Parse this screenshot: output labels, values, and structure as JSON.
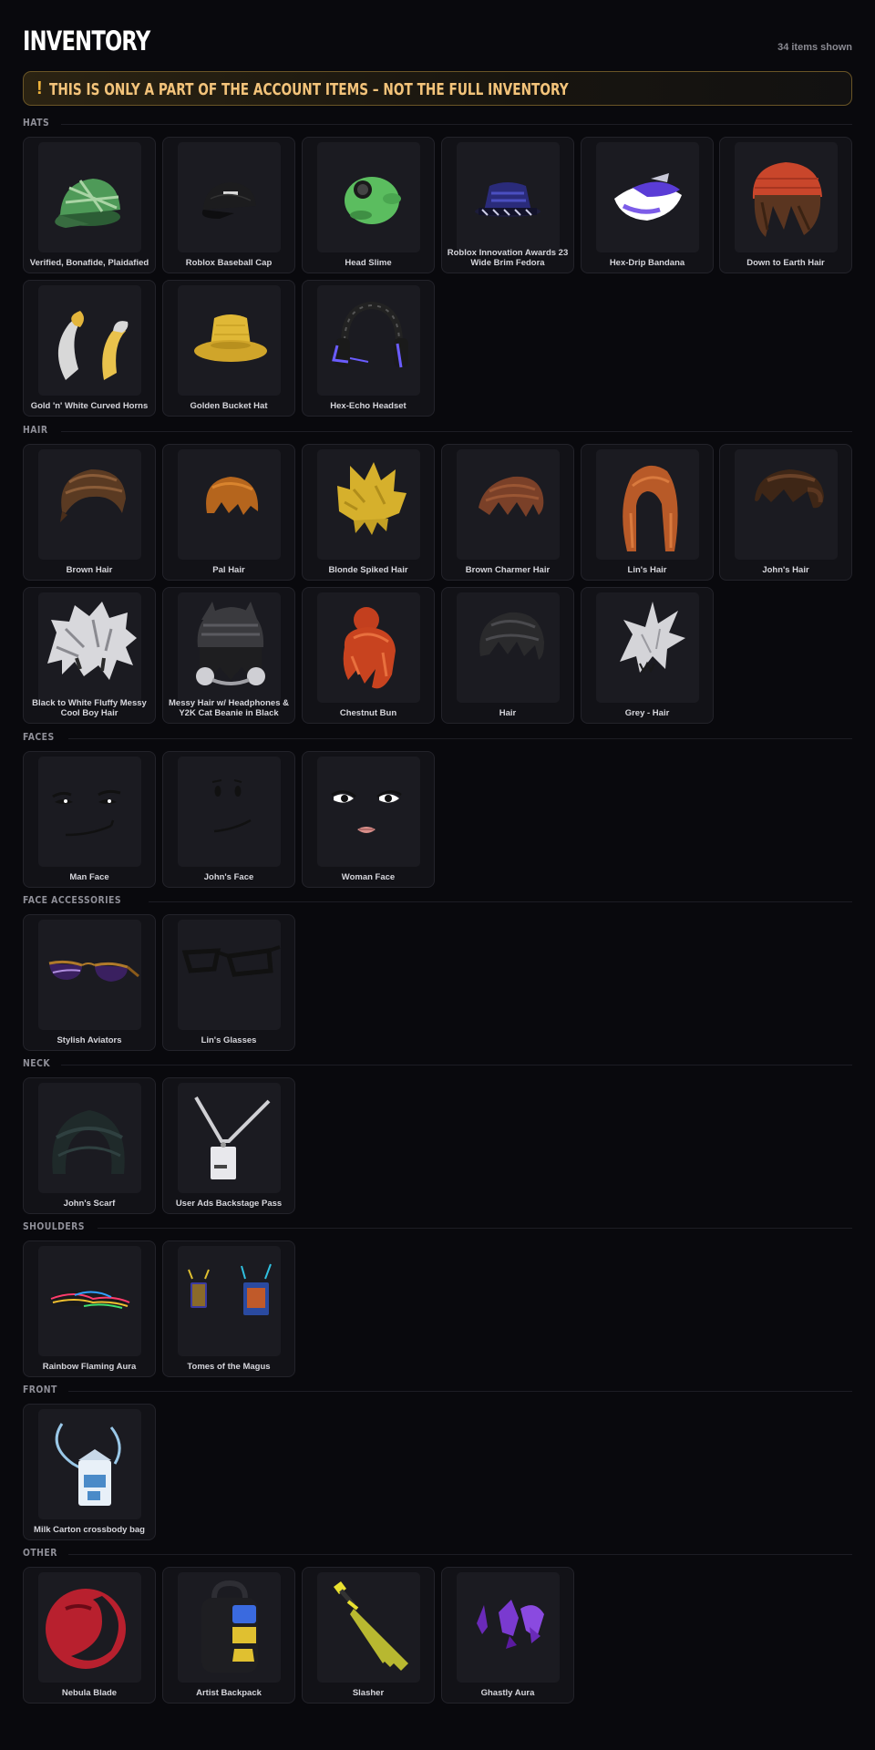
{
  "header": {
    "title": "INVENTORY",
    "count": "34 items shown"
  },
  "warning": {
    "mark": "!",
    "text": "THIS IS ONLY A PART OF THE ACCOUNT ITEMS – NOT THE FULL INVENTORY"
  },
  "sections": {
    "hats": {
      "label": "HATS",
      "items": [
        {
          "name": "Verified, Bonafide, Plaidafied",
          "icon": "green-plaid-cap-icon"
        },
        {
          "name": "Roblox Baseball Cap",
          "icon": "black-baseball-cap-icon"
        },
        {
          "name": "Head Slime",
          "icon": "green-slime-head-icon"
        },
        {
          "name": "Roblox Innovation Awards 23 Wide Brim Fedora",
          "icon": "blue-fedora-icon"
        },
        {
          "name": "Hex-Drip Bandana",
          "icon": "bandana-icon"
        },
        {
          "name": "Down to Earth Hair",
          "icon": "beanie-hair-icon"
        },
        {
          "name": "Gold 'n' White Curved Horns",
          "icon": "horns-icon"
        },
        {
          "name": "Golden Bucket Hat",
          "icon": "bucket-hat-icon"
        },
        {
          "name": "Hex-Echo Headset",
          "icon": "headset-icon"
        }
      ]
    },
    "hair": {
      "label": "HAIR",
      "items": [
        {
          "name": "Brown Hair",
          "icon": "brown-hair-icon"
        },
        {
          "name": "Pal Hair",
          "icon": "orange-hair-icon"
        },
        {
          "name": "Blonde Spiked Hair",
          "icon": "blonde-spiked-hair-icon"
        },
        {
          "name": "Brown Charmer Hair",
          "icon": "brown-charmer-hair-icon"
        },
        {
          "name": "Lin's Hair",
          "icon": "long-orange-hair-icon"
        },
        {
          "name": "John's Hair",
          "icon": "dark-brown-hair-icon"
        },
        {
          "name": "Black to White Fluffy Messy Cool Boy Hair",
          "icon": "fluffy-white-hair-icon"
        },
        {
          "name": "Messy Hair w/ Headphones & Y2K Cat Beanie in Black",
          "icon": "beanie-headphones-icon"
        },
        {
          "name": "Chestnut Bun",
          "icon": "red-bun-hair-icon"
        },
        {
          "name": "Hair",
          "icon": "black-hair-icon"
        },
        {
          "name": "Grey - Hair",
          "icon": "grey-spiky-hair-icon"
        }
      ]
    },
    "faces": {
      "label": "FACES",
      "items": [
        {
          "name": "Man Face",
          "icon": "man-face-icon"
        },
        {
          "name": "John's Face",
          "icon": "smile-face-icon"
        },
        {
          "name": "Woman Face",
          "icon": "woman-face-icon"
        }
      ]
    },
    "face_accessories": {
      "label": "FACE ACCESSORIES",
      "items": [
        {
          "name": "Stylish Aviators",
          "icon": "aviator-glasses-icon"
        },
        {
          "name": "Lin's Glasses",
          "icon": "black-glasses-icon"
        }
      ]
    },
    "neck": {
      "label": "NECK",
      "items": [
        {
          "name": "John's Scarf",
          "icon": "scarf-icon"
        },
        {
          "name": "User Ads Backstage Pass",
          "icon": "lanyard-pass-icon"
        }
      ]
    },
    "shoulders": {
      "label": "SHOULDERS",
      "items": [
        {
          "name": "Rainbow Flaming Aura",
          "icon": "flaming-aura-icon"
        },
        {
          "name": "Tomes of the Magus",
          "icon": "tomes-icon"
        }
      ]
    },
    "front": {
      "label": "FRONT",
      "items": [
        {
          "name": "Milk Carton crossbody bag",
          "icon": "milk-carton-bag-icon"
        }
      ]
    },
    "other": {
      "label": "OTHER",
      "items": [
        {
          "name": "Nebula Blade",
          "icon": "nebula-blade-icon"
        },
        {
          "name": "Artist Backpack",
          "icon": "backpack-icon"
        },
        {
          "name": "Slasher",
          "icon": "slasher-sword-icon"
        },
        {
          "name": "Ghastly Aura",
          "icon": "ghastly-aura-icon"
        }
      ]
    }
  }
}
